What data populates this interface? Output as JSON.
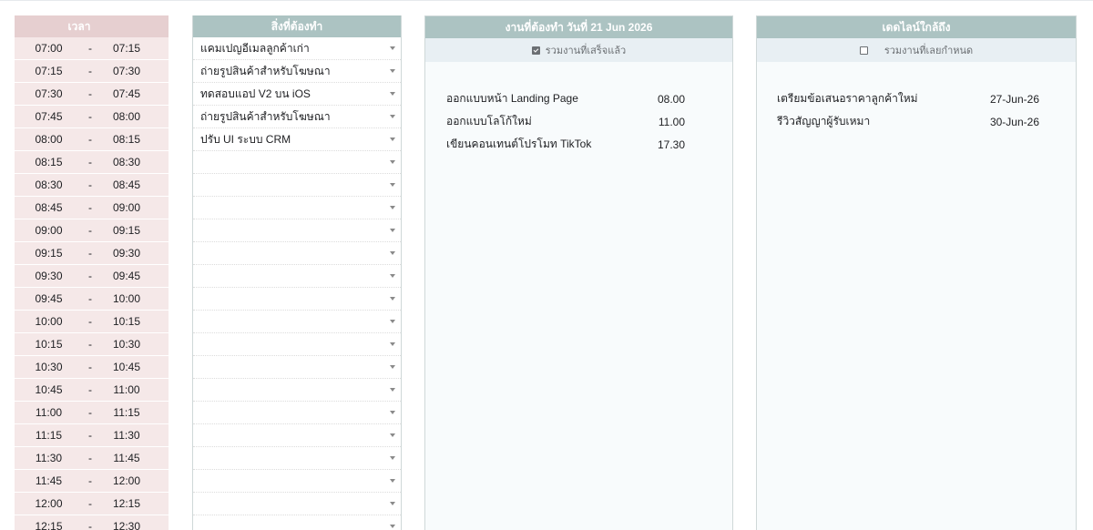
{
  "time_panel": {
    "header": "เวลา",
    "separator": "-",
    "rows": [
      {
        "start": "07:00",
        "end": "07:15"
      },
      {
        "start": "07:15",
        "end": "07:30"
      },
      {
        "start": "07:30",
        "end": "07:45"
      },
      {
        "start": "07:45",
        "end": "08:00"
      },
      {
        "start": "08:00",
        "end": "08:15"
      },
      {
        "start": "08:15",
        "end": "08:30"
      },
      {
        "start": "08:30",
        "end": "08:45"
      },
      {
        "start": "08:45",
        "end": "09:00"
      },
      {
        "start": "09:00",
        "end": "09:15"
      },
      {
        "start": "09:15",
        "end": "09:30"
      },
      {
        "start": "09:30",
        "end": "09:45"
      },
      {
        "start": "09:45",
        "end": "10:00"
      },
      {
        "start": "10:00",
        "end": "10:15"
      },
      {
        "start": "10:15",
        "end": "10:30"
      },
      {
        "start": "10:30",
        "end": "10:45"
      },
      {
        "start": "10:45",
        "end": "11:00"
      },
      {
        "start": "11:00",
        "end": "11:15"
      },
      {
        "start": "11:15",
        "end": "11:30"
      },
      {
        "start": "11:30",
        "end": "11:45"
      },
      {
        "start": "11:45",
        "end": "12:00"
      },
      {
        "start": "12:00",
        "end": "12:15"
      },
      {
        "start": "12:15",
        "end": "12:30"
      }
    ]
  },
  "todo_panel": {
    "header": "สิ่งที่ต้องทำ",
    "rows": [
      "แคมเปญอีเมลลูกค้าเก่า",
      "ถ่ายรูปสินค้าสำหรับโฆษณา",
      "ทดสอบแอป V2 บน iOS",
      "ถ่ายรูปสินค้าสำหรับโฆษณา",
      "ปรับ UI ระบบ CRM",
      "",
      "",
      "",
      "",
      "",
      "",
      "",
      "",
      "",
      "",
      "",
      "",
      "",
      "",
      "",
      "",
      ""
    ]
  },
  "today_panel": {
    "header": "งานที่ต้องทำ วันที่ 21 Jun 2026",
    "include_done_label": "รวมงานที่เสร็จแล้ว",
    "include_done_checked": true,
    "tasks": [
      {
        "name": "ออกแบบหน้า Landing Page",
        "time": "08.00"
      },
      {
        "name": "ออกแบบโลโก้ใหม่",
        "time": "11.00"
      },
      {
        "name": "เขียนคอนเทนต์โปรโมท TikTok",
        "time": "17.30"
      }
    ]
  },
  "deadline_panel": {
    "header": "เดดไลน์ใกล้ถึง",
    "include_overdue_label": "รวมงานที่เลยกำหนด",
    "include_overdue_checked": false,
    "tasks": [
      {
        "name": "เตรียมข้อเสนอราคาลูกค้าใหม่",
        "date": "27-Jun-26"
      },
      {
        "name": "รีวิวสัญญาผู้รับเหมา",
        "date": "30-Jun-26"
      }
    ]
  },
  "colors": {
    "time_bg": "#f5e8e8",
    "time_header": "#e6cfd0",
    "panel_header": "#acc3c2",
    "panel_bg": "#f8fbfc",
    "sub_bar": "#e8eff3"
  }
}
